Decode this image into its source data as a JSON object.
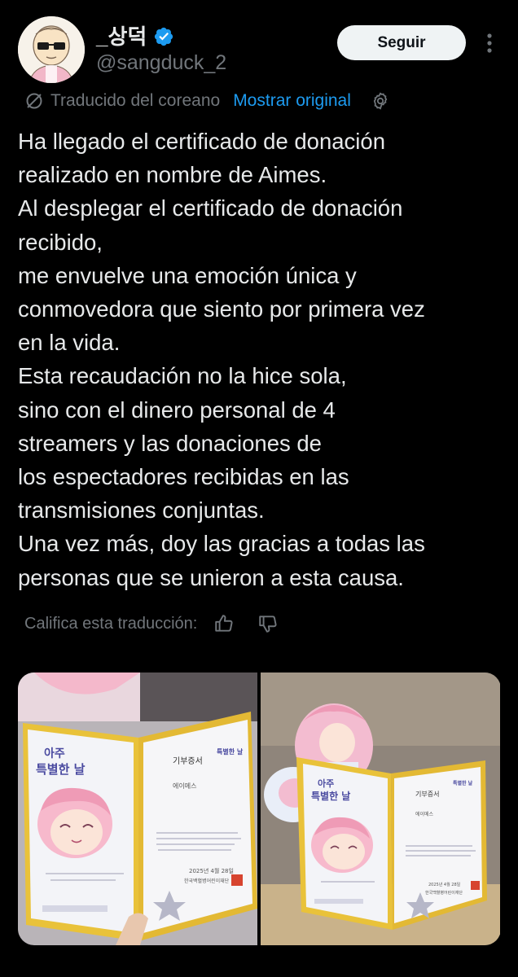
{
  "author": {
    "name": "_상덕",
    "handle": "@sangduck_2",
    "verified_icon": "verified-badge-icon",
    "avatar_icon": "avatar-image"
  },
  "actions": {
    "follow_label": "Seguir",
    "more_icon": "more-vertical-icon"
  },
  "translation": {
    "status": "Traducido del coreano",
    "show_original": "Mostrar original",
    "status_icon": "globe-slash-icon",
    "settings_icon": "gear-icon"
  },
  "tweet": {
    "lines": [
      "Ha llegado el certificado de donación",
      "realizado en nombre de Aimes.",
      "Al desplegar el certificado de donación",
      "recibido,",
      "me envuelve una emoción única y",
      "conmovedora que siento por primera vez",
      "en la vida.",
      "Esta recaudación no la hice sola,",
      "sino con el dinero personal de 4",
      "streamers y las donaciones de",
      "los espectadores recibidas en las",
      "transmisiones conjuntas.",
      "Una vez más, doy las gracias a todas las",
      "personas que se unieron a esta causa."
    ]
  },
  "rating": {
    "label": "Califica esta traducción:",
    "like_icon": "thumbs-up-icon",
    "dislike_icon": "thumbs-down-icon"
  },
  "colors": {
    "background": "#000000",
    "text": "#e7e9ea",
    "muted": "#71767b",
    "accent": "#1d9bf0",
    "verified": "#1d9bf0",
    "button_bg": "#eff3f4"
  },
  "media": {
    "photos": [
      {
        "title_lines": [
          "아주",
          "특별한 날"
        ],
        "right_page_title": "기부증서",
        "recipient": "에이메스",
        "date": "2025년 4월 28일",
        "org": "한국백혈병어린이재단"
      },
      {
        "title_lines": [
          "아주",
          "특별한 날"
        ],
        "right_page_title": "기부증서",
        "recipient": "에이메스",
        "date": "2025년 4월 28일",
        "org": "한국백혈병어린이재단"
      }
    ]
  }
}
